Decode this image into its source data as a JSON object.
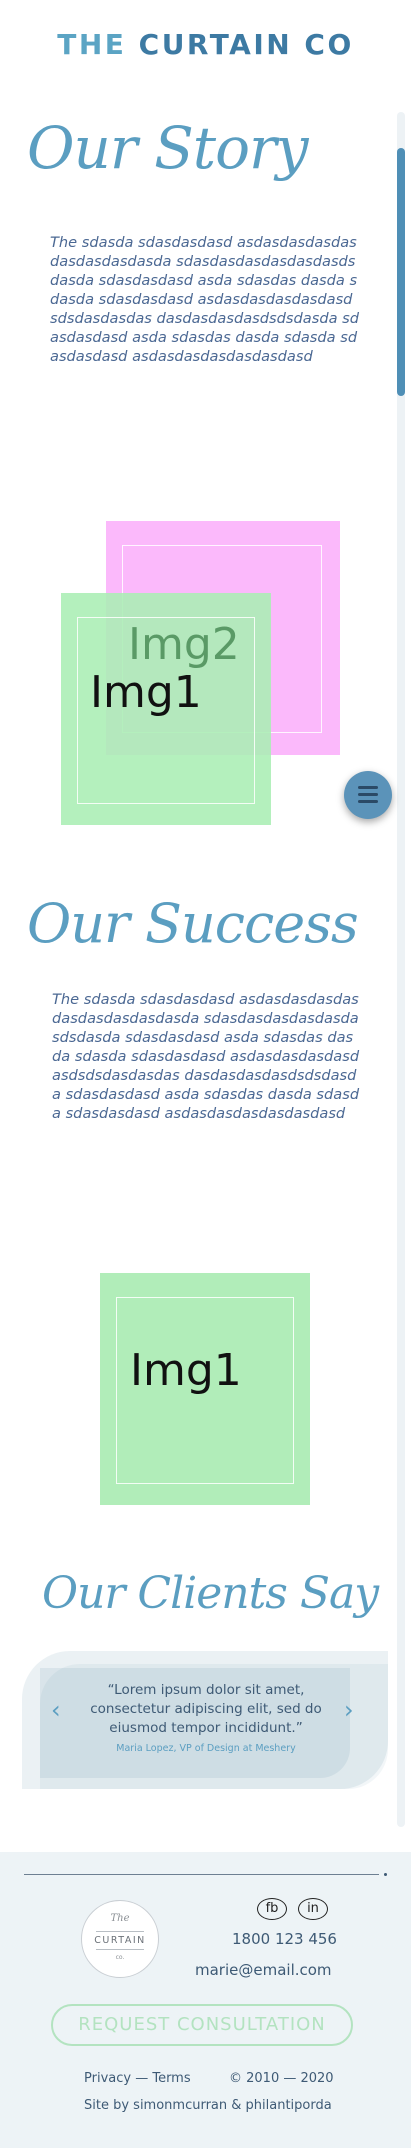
{
  "brand": {
    "the": "THE",
    "rest": "CURTAIN CO"
  },
  "story": {
    "heading": "Our Story",
    "text": "The sdasda sdasdasdasd asdasdasdasdasdasdasdasdasda sdasdasdasdasdasdasdsdasda sdasdasdasd asda sdasdas dasda sdasda sdasdasdasd asdasdasdasdasdasdsdsdasdasdas dasdasdasdasdsdsdasda sdasdasdasd asda sdasdas dasda sdasda sdasdasdasd asdasdasdasdasdasdasd",
    "img1_label": "Img1",
    "img2_label": "Img2"
  },
  "success": {
    "heading": "Our Success",
    "text": "The sdasda sdasdasdasd asdasdasdasdasdasdasdasdasdasda sdasdasdasdasdasdasdsdasda sdasdasdasd asda sdasdas dasda sdasda sdasdasdasd asdasdasdasdasdasdsdsdasdasdas dasdasdasdasdsdsdasda sdasdasdasd asda sdasdas dasda sdasda sdasdasdasd asdasdasdasdasdasdasd",
    "img1_label": "Img1"
  },
  "clients": {
    "heading": "Our Clients Say",
    "quote": "“Lorem ipsum dolor sit amet, consectetur adipiscing elit, sed do eiusmod tempor incididunt.”",
    "author": "Maria Lopez, VP of Design at Meshery",
    "prev_icon": "chevron-left-icon",
    "next_icon": "chevron-right-icon",
    "prev_glyph": "‹",
    "next_glyph": "›"
  },
  "menu": {
    "icon": "hamburger-menu-icon"
  },
  "footer": {
    "logo": {
      "the": "The",
      "name": "CURTAIN",
      "co": "co."
    },
    "social": [
      {
        "label": "fb",
        "icon": "facebook-icon"
      },
      {
        "label": "in",
        "icon": "linkedin-icon"
      }
    ],
    "phone": "1800 123 456",
    "email": "marie@email.com",
    "cta": "REQUEST CONSULTATION",
    "links": "Privacy — Terms",
    "copyright": "© 2010 — 2020",
    "credit": "Site by simonmcurran & philantiporda"
  },
  "colors": {
    "brand": "#3d7aa3",
    "script_heading": "#5b9ec1",
    "body_text": "#4b6893",
    "img_green": "#b1edb9",
    "img_pink": "#fbb9fb",
    "cta_border": "#b3e3c0",
    "footer_bg": "#edf3f6"
  }
}
